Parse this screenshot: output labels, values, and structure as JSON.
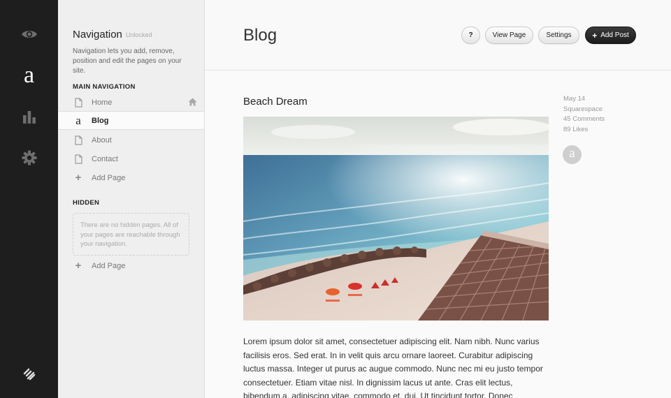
{
  "rail": {
    "items": [
      {
        "icon": "eye-icon"
      },
      {
        "icon": "squarespace-a-icon",
        "glyph": "a",
        "active": true
      },
      {
        "icon": "bar-chart-icon"
      },
      {
        "icon": "gear-icon"
      }
    ],
    "logo": "squarespace-logo-icon"
  },
  "nav": {
    "title": "Navigation",
    "lock_status": "Unlocked",
    "description": "Navigation lets you add, remove, position and edit the pages on your site.",
    "main_heading": "MAIN NAVIGATION",
    "main_items": [
      {
        "label": "Home",
        "icon": "page-icon",
        "is_home": true
      },
      {
        "label": "Blog",
        "icon": "blog-a-icon",
        "active": true
      },
      {
        "label": "About",
        "icon": "page-icon"
      },
      {
        "label": "Contact",
        "icon": "page-icon"
      }
    ],
    "add_page_label": "Add Page",
    "hidden_heading": "HIDDEN",
    "hidden_empty_text": "There are no hidden pages. All of your pages are reachable through your navigation.",
    "hidden_add_page_label": "Add Page"
  },
  "header": {
    "title": "Blog",
    "help_label": "?",
    "view_page_label": "View Page",
    "settings_label": "Settings",
    "add_post_label": "Add Post"
  },
  "post": {
    "title": "Beach Dream",
    "meta": {
      "date": "May 14",
      "author": "Squarespace",
      "comments": "45 Comments",
      "likes": "89 Likes"
    },
    "avatar_glyph": "a",
    "body": "Lorem ipsum dolor sit amet, consectetuer adipiscing elit. Nam nibh. Nunc varius facilisis eros. Sed erat. In in velit quis arcu ornare laoreet. Curabitur adipiscing luctus massa. Integer ut purus ac augue commodo. Nunc nec mi eu justo tempor consectetuer. Etiam vitae nisl. In dignissim lacus ut ante. Cras elit lectus, bibendum a, adipiscing vitae, commodo et, dui. Ut tincidunt tortor. Donec nonummy, enim in"
  },
  "colors": {
    "rail_bg": "#1e1e1e",
    "panel_bg": "#efefef",
    "primary_button": "#222222"
  }
}
